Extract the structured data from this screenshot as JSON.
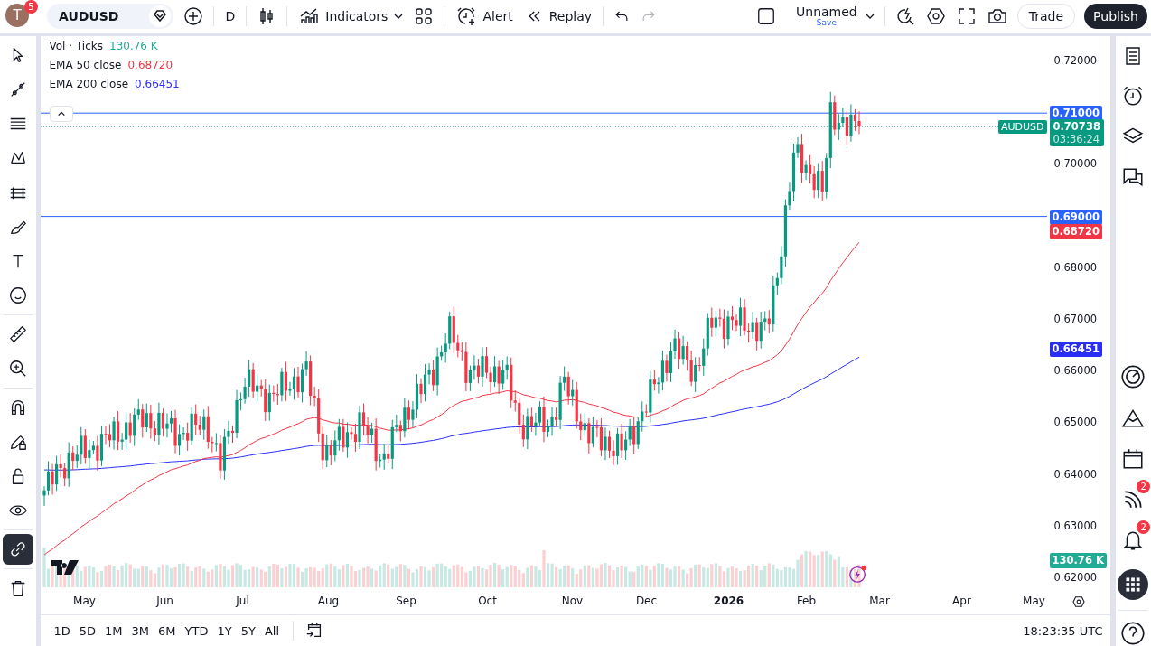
{
  "toolbar": {
    "avatar_letter": "T",
    "notification_count": "5",
    "symbol": "AUDUSD",
    "interval": "D",
    "indicators_label": "Indicators",
    "alert_label": "Alert",
    "replay_label": "Replay",
    "layout_name": "Unnamed",
    "save_label": "Save",
    "trade_label": "Trade",
    "publish_label": "Publish"
  },
  "left_tools": [
    {
      "kind": "cursor",
      "selected": false
    },
    {
      "kind": "trend-line",
      "selected": false
    },
    {
      "kind": "fib-lines",
      "selected": false
    },
    {
      "kind": "pattern",
      "selected": false
    },
    {
      "kind": "projection",
      "selected": false
    },
    {
      "kind": "brush",
      "selected": false
    },
    {
      "kind": "text",
      "selected": false
    },
    {
      "kind": "emoji",
      "selected": false
    },
    {
      "kind": "ruler",
      "selected": false
    },
    {
      "kind": "zoom-in",
      "selected": false
    },
    {
      "kind": "magnet",
      "selected": false
    },
    {
      "kind": "pencil-lock",
      "selected": false
    },
    {
      "kind": "lock",
      "selected": false
    },
    {
      "kind": "eye",
      "selected": false
    },
    {
      "kind": "link",
      "selected": true
    },
    {
      "kind": "trash",
      "selected": false
    }
  ],
  "legend": [
    {
      "label": "Vol · Ticks",
      "value": "130.76 K",
      "color": "#22ab94"
    },
    {
      "label": "EMA 50 close",
      "value": "0.68720",
      "color": "#f23645"
    },
    {
      "label": "EMA 200 close",
      "value": "0.66451",
      "color": "#2a2ef5"
    }
  ],
  "price_axis": [
    "0.72000",
    "0.70000",
    "0.68000",
    "0.67000",
    "0.66000",
    "0.65000",
    "0.64000",
    "0.63000",
    "0.62000"
  ],
  "price_tags": [
    {
      "kind": "line",
      "text": "0.71000",
      "color": "#2962ff"
    },
    {
      "kind": "last",
      "symbol": "AUDUSD",
      "text": "0.70738",
      "countdown": "03:36:24",
      "color": "#089981"
    },
    {
      "kind": "line",
      "text": "0.69000",
      "color": "#2962ff"
    },
    {
      "kind": "ema",
      "text": "0.68720",
      "color": "#f23645"
    },
    {
      "kind": "ema",
      "text": "0.66451",
      "color": "#2a2ef5"
    },
    {
      "kind": "volume",
      "text": "130.76 K",
      "color": "#22ab94"
    }
  ],
  "time_axis": [
    {
      "label": "May",
      "bold": false
    },
    {
      "label": "Jun",
      "bold": false
    },
    {
      "label": "Jul",
      "bold": false
    },
    {
      "label": "Aug",
      "bold": false
    },
    {
      "label": "Sep",
      "bold": false
    },
    {
      "label": "Oct",
      "bold": false
    },
    {
      "label": "Nov",
      "bold": false
    },
    {
      "label": "Dec",
      "bold": false
    },
    {
      "label": "2026",
      "bold": true
    },
    {
      "label": "Feb",
      "bold": false
    },
    {
      "label": "Mar",
      "bold": false
    },
    {
      "label": "Apr",
      "bold": false
    },
    {
      "label": "May",
      "bold": false
    }
  ],
  "ranges": [
    "1D",
    "5D",
    "1M",
    "3M",
    "6M",
    "YTD",
    "1Y",
    "5Y",
    "All"
  ],
  "clock": "18:23:35 UTC",
  "right_sidebar": {
    "feed_badge": "2",
    "alerts_badge": "2"
  }
}
